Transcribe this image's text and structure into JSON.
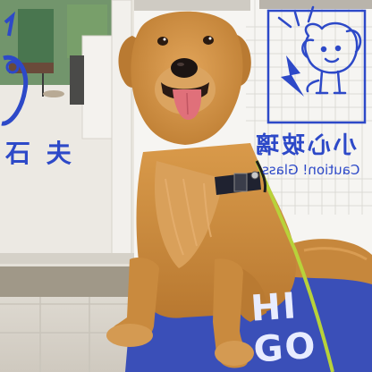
{
  "scene": {
    "window_sign": {
      "chinese": "小心玻璃",
      "english": "Caution! Glass"
    },
    "left_sign_text": "石 夫",
    "mat_text": "HI GO"
  },
  "colors": {
    "sign_blue": "#2d49c8",
    "mat_blue": "#3a4fb8",
    "fur_gold": "#c98a3e",
    "leash_green": "#b8d23a"
  }
}
